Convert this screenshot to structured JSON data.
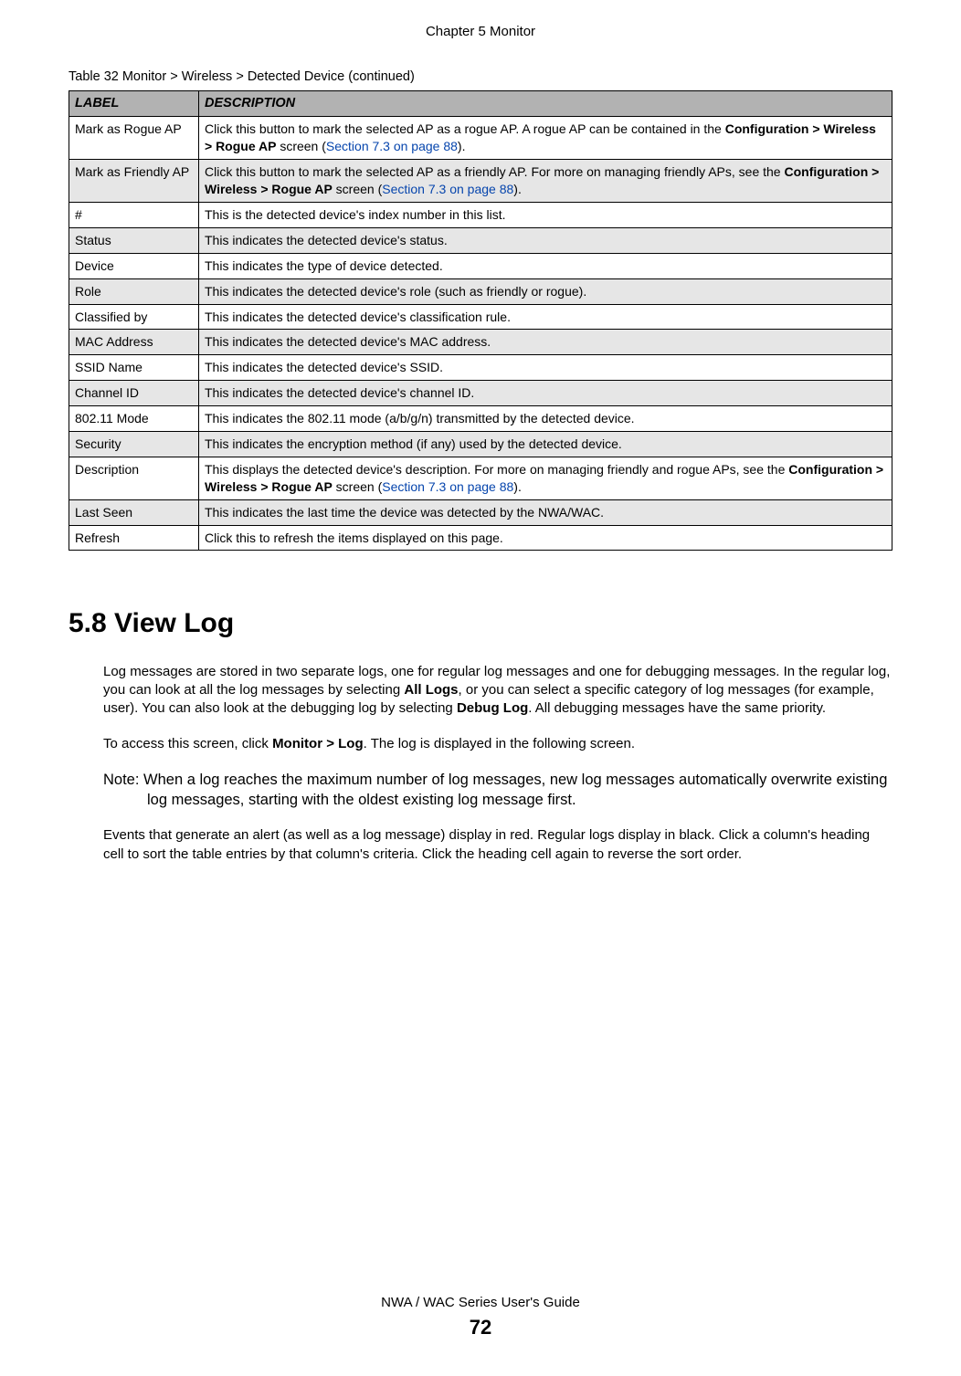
{
  "chapter_header": "Chapter 5 Monitor",
  "table": {
    "caption": "Table 32   Monitor > Wireless > Detected Device (continued)",
    "header_label": "LABEL",
    "header_desc": "DESCRIPTION",
    "rows": [
      {
        "label": "Mark as Rogue AP",
        "desc_pre": "Click this button to mark the selected AP as a rogue AP. A rogue AP can be contained in the ",
        "desc_bold": "Configuration > Wireless > Rogue AP",
        "desc_mid": " screen (",
        "desc_link": "Section 7.3 on page 88",
        "desc_post": ")."
      },
      {
        "label": "Mark as Friendly AP",
        "desc_pre": "Click this button to mark the selected AP as a friendly AP. For more on managing friendly APs, see the ",
        "desc_bold": "Configuration > Wireless > Rogue AP",
        "desc_mid": " screen (",
        "desc_link": "Section 7.3 on page 88",
        "desc_post": ")."
      },
      {
        "label": "#",
        "desc_pre": "This is the detected device's index number in this list.",
        "desc_bold": "",
        "desc_mid": "",
        "desc_link": "",
        "desc_post": ""
      },
      {
        "label": "Status",
        "desc_pre": "This indicates the detected device's status.",
        "desc_bold": "",
        "desc_mid": "",
        "desc_link": "",
        "desc_post": ""
      },
      {
        "label": "Device",
        "desc_pre": "This indicates the type of device detected.",
        "desc_bold": "",
        "desc_mid": "",
        "desc_link": "",
        "desc_post": ""
      },
      {
        "label": "Role",
        "desc_pre": "This indicates the detected device's role (such as friendly or rogue).",
        "desc_bold": "",
        "desc_mid": "",
        "desc_link": "",
        "desc_post": ""
      },
      {
        "label": "Classified by",
        "desc_pre": "This indicates the detected device's classification rule.",
        "desc_bold": "",
        "desc_mid": "",
        "desc_link": "",
        "desc_post": ""
      },
      {
        "label": "MAC Address",
        "desc_pre": "This indicates the detected device's MAC address.",
        "desc_bold": "",
        "desc_mid": "",
        "desc_link": "",
        "desc_post": ""
      },
      {
        "label": "SSID Name",
        "desc_pre": "This indicates the detected device's SSID.",
        "desc_bold": "",
        "desc_mid": "",
        "desc_link": "",
        "desc_post": ""
      },
      {
        "label": "Channel ID",
        "desc_pre": "This indicates the detected device's channel ID.",
        "desc_bold": "",
        "desc_mid": "",
        "desc_link": "",
        "desc_post": ""
      },
      {
        "label": "802.11 Mode",
        "desc_pre": "This indicates the 802.11 mode (a/b/g/n) transmitted by the detected device.",
        "desc_bold": "",
        "desc_mid": "",
        "desc_link": "",
        "desc_post": ""
      },
      {
        "label": "Security",
        "desc_pre": "This indicates the encryption method (if any) used by the detected device.",
        "desc_bold": "",
        "desc_mid": "",
        "desc_link": "",
        "desc_post": ""
      },
      {
        "label": "Description",
        "desc_pre": "This displays the detected device's description. For more on managing friendly and rogue APs, see the ",
        "desc_bold": "Configuration > Wireless > Rogue AP",
        "desc_mid": " screen (",
        "desc_link": "Section 7.3 on page 88",
        "desc_post": ")."
      },
      {
        "label": "Last Seen",
        "desc_pre": "This indicates the last time the device was detected by the NWA/WAC.",
        "desc_bold": "",
        "desc_mid": "",
        "desc_link": "",
        "desc_post": ""
      },
      {
        "label": "Refresh",
        "desc_pre": "Click this to refresh the items displayed on this page.",
        "desc_bold": "",
        "desc_mid": "",
        "desc_link": "",
        "desc_post": ""
      }
    ]
  },
  "section": {
    "heading": "5.8  View Log",
    "p1_pre": "Log messages are stored in two separate logs, one for regular log messages and one for debugging messages. In the regular log, you can look at all the log messages by selecting ",
    "p1_b1": "All Logs",
    "p1_mid": ", or you can select a specific category of log messages (for example, user). You can also look at the debugging log by selecting ",
    "p1_b2": "Debug Log",
    "p1_post": ". All debugging messages have the same priority.",
    "p2_pre": "To access this screen, click ",
    "p2_b1": "Monitor > Log",
    "p2_post": ". The log is displayed in the following screen.",
    "note": "Note: When a log reaches the maximum number of log messages, new log messages automatically overwrite existing log messages, starting with the oldest existing log message first.",
    "p3": "Events that generate an alert (as well as a log message) display in red. Regular logs display in black. Click a column's heading cell to sort the table entries by that column's criteria. Click the heading cell again to reverse the sort order."
  },
  "footer": {
    "title": "NWA / WAC Series User's Guide",
    "page": "72"
  }
}
